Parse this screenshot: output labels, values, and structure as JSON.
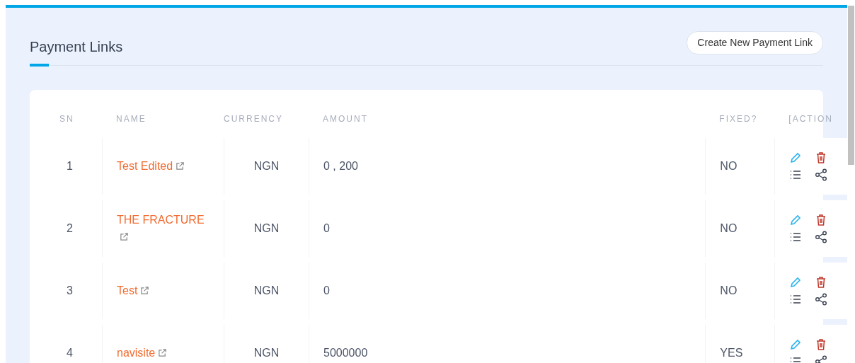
{
  "page": {
    "title": "Payment Links",
    "create_button": "Create New Payment Link"
  },
  "table": {
    "columns": [
      "SN",
      "NAME",
      "CURRENCY",
      "AMOUNT",
      "FIXED?",
      "[ACTION"
    ],
    "rows": [
      {
        "sn": "1",
        "name": "Test Edited",
        "currency": "NGN",
        "amount": "0 , 200",
        "fixed": "NO"
      },
      {
        "sn": "2",
        "name": "THE FRACTURE",
        "currency": "NGN",
        "amount": "0",
        "fixed": "NO"
      },
      {
        "sn": "3",
        "name": "Test",
        "currency": "NGN",
        "amount": "0",
        "fixed": "NO"
      },
      {
        "sn": "4",
        "name": "navisite",
        "currency": "NGN",
        "amount": "5000000",
        "fixed": "YES"
      }
    ]
  }
}
